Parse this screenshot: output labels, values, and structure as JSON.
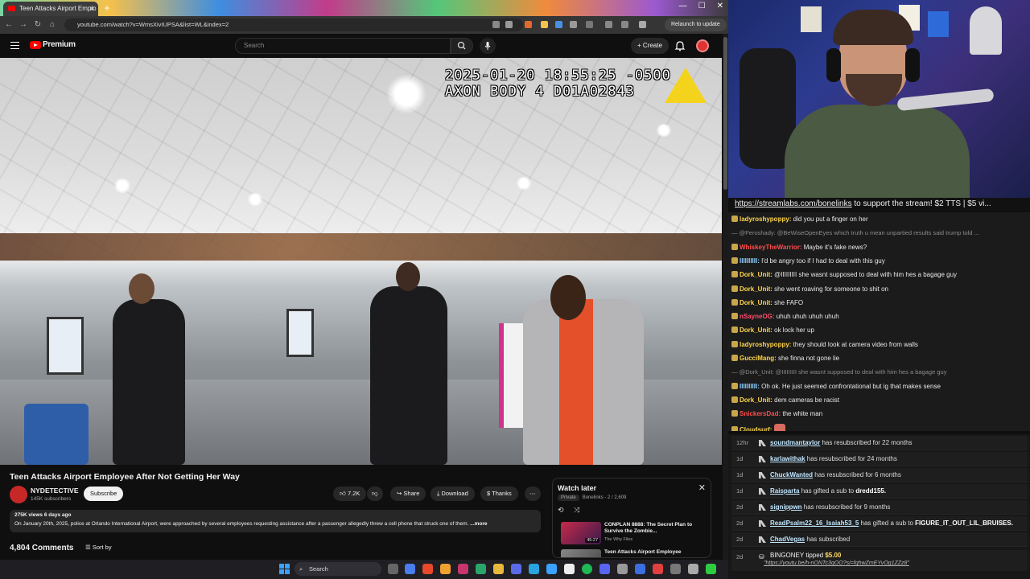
{
  "browser": {
    "tab_title": "Teen Attacks Airport Emplo",
    "url": "youtube.com/watch?v=WmsXivIUPSA&list=WL&index=2",
    "relaunch_label": "Relaunch to update"
  },
  "youtube": {
    "brand": "Premium",
    "search_placeholder": "Search",
    "create_label": "+ Create"
  },
  "video": {
    "osd_line1": "2025-01-20 18:55:25 -0500",
    "osd_line2": "AXON BODY 4 D01A02843",
    "title": "Teen Attacks Airport Employee After Not Getting Her Way",
    "channel": "NYDETECTIVE",
    "subscribers": "145K subscribers",
    "subscribe_label": "Subscribe",
    "likes": "7.2K",
    "share_label": "Share",
    "download_label": "Download",
    "thanks_label": "Thanks",
    "views_date": "275K views  6 days ago",
    "description": "On January 20th, 2025, police at Orlando International Airport, were approached by several employees requesting assistance after a passenger allegedly threw a cell phone that struck one of them.",
    "more_label": "...more",
    "comments_count": "4,804 Comments",
    "sort_label": "Sort by"
  },
  "watch_later": {
    "title": "Watch later",
    "privacy": "Private",
    "owner": "Bonelinks",
    "position": "- 2 / 2,609",
    "items": [
      {
        "title": "CONPLAN 8888: The Secret Plan to Survive the Zombie...",
        "channel": "The Why Files",
        "duration": "45:27"
      },
      {
        "title": "Teen Attacks Airport Employee",
        "channel": "",
        "duration": ""
      }
    ]
  },
  "taskbar": {
    "search_label": "Search"
  },
  "stream": {
    "ticker_link": "https://streamlabs.com/bonelinks",
    "ticker_text": " to support the stream! $2 TTS | $5 vi..."
  },
  "chat": [
    {
      "user": "ladyroshypoppy",
      "color": "#ffd54a",
      "text": " did you put a finger on her",
      "reply": false
    },
    {
      "user": "",
      "color": "",
      "text": "— @Feroshady: @BeWiseOpenEyes which truth u mean unpartied results said trump told ...",
      "reply": true
    },
    {
      "user": "WhiskeyTheWarrior",
      "color": "#ff4d4d",
      "text": " Maybe it's fake news?",
      "reply": false
    },
    {
      "user": "IIIIIIIIII",
      "color": "#8fd0ff",
      "text": " I'd be angry too if I had to deal with this guy",
      "reply": false
    },
    {
      "user": "Dork_Unit",
      "color": "#ffd54a",
      "text": " @IIIIIIIII she wasnt supposed to deal with him hes a bagage guy",
      "reply": false
    },
    {
      "user": "Dork_Unit",
      "color": "#ffd54a",
      "text": " she went roaving for someone to shit on",
      "reply": false
    },
    {
      "user": "Dork_Unit",
      "color": "#ffd54a",
      "text": " she FAFO",
      "reply": false
    },
    {
      "user": "nSayneOG",
      "color": "#ff4d6d",
      "text": " uhuh uhuh uhuh uhuh",
      "reply": false
    },
    {
      "user": "Dork_Unit",
      "color": "#ffd54a",
      "text": " ok lock her up",
      "reply": false
    },
    {
      "user": "ladyroshypoppy",
      "color": "#ffd54a",
      "text": " they should look at camera video from walls",
      "reply": false
    },
    {
      "user": "GucciMang",
      "color": "#ffd54a",
      "text": " she finna not gone lie",
      "reply": false
    },
    {
      "user": "",
      "color": "",
      "text": "— @Dork_Unit: @IIIIIIIII she wasnt supposed to deal with him hes a bagage guy",
      "reply": true
    },
    {
      "user": "IIIIIIIIII",
      "color": "#8fd0ff",
      "text": " Oh ok. He just seemed confrontational but ig that makes sense",
      "reply": false
    },
    {
      "user": "Dork_Unit",
      "color": "#ffd54a",
      "text": " dem cameras be racist",
      "reply": false
    },
    {
      "user": "SnickersDad",
      "color": "#ff4d4d",
      "text": " the white man",
      "reply": false
    },
    {
      "user": "Cloudsurf",
      "color": "#ffd54a",
      "text": " ",
      "reply": false
    }
  ],
  "events": [
    {
      "time": "12hr",
      "name": "soundmantaylor",
      "action": " has resubscribed for 22 months",
      "target": ""
    },
    {
      "time": "1d",
      "name": "karlawithak",
      "action": " has resubscribed for 24 months",
      "target": ""
    },
    {
      "time": "1d",
      "name": "ChuckWanted",
      "action": " has resubscribed for 6 months",
      "target": ""
    },
    {
      "time": "1d",
      "name": "Raisparta",
      "action": " has gifted a sub to ",
      "target": "dredd155."
    },
    {
      "time": "2d",
      "name": "signippwn",
      "action": " has resubscribed for 9 months",
      "target": ""
    },
    {
      "time": "2d",
      "name": "ReadPsalm22_16_Isaiah53_5",
      "action": " has gifted a sub to ",
      "target": "FIGURE_IT_OUT_LIL_BRUISES."
    },
    {
      "time": "2d",
      "name": "ChadVegas",
      "action": " has subscribed",
      "target": ""
    }
  ],
  "tip": {
    "time": "2d",
    "name": "BINGONEY",
    "action": " tipped ",
    "amount": "$5.00",
    "link": "\"https://youtu.be/h-nONTc3qOO?si=fqhwZmEYvOg1ZZz8\""
  }
}
